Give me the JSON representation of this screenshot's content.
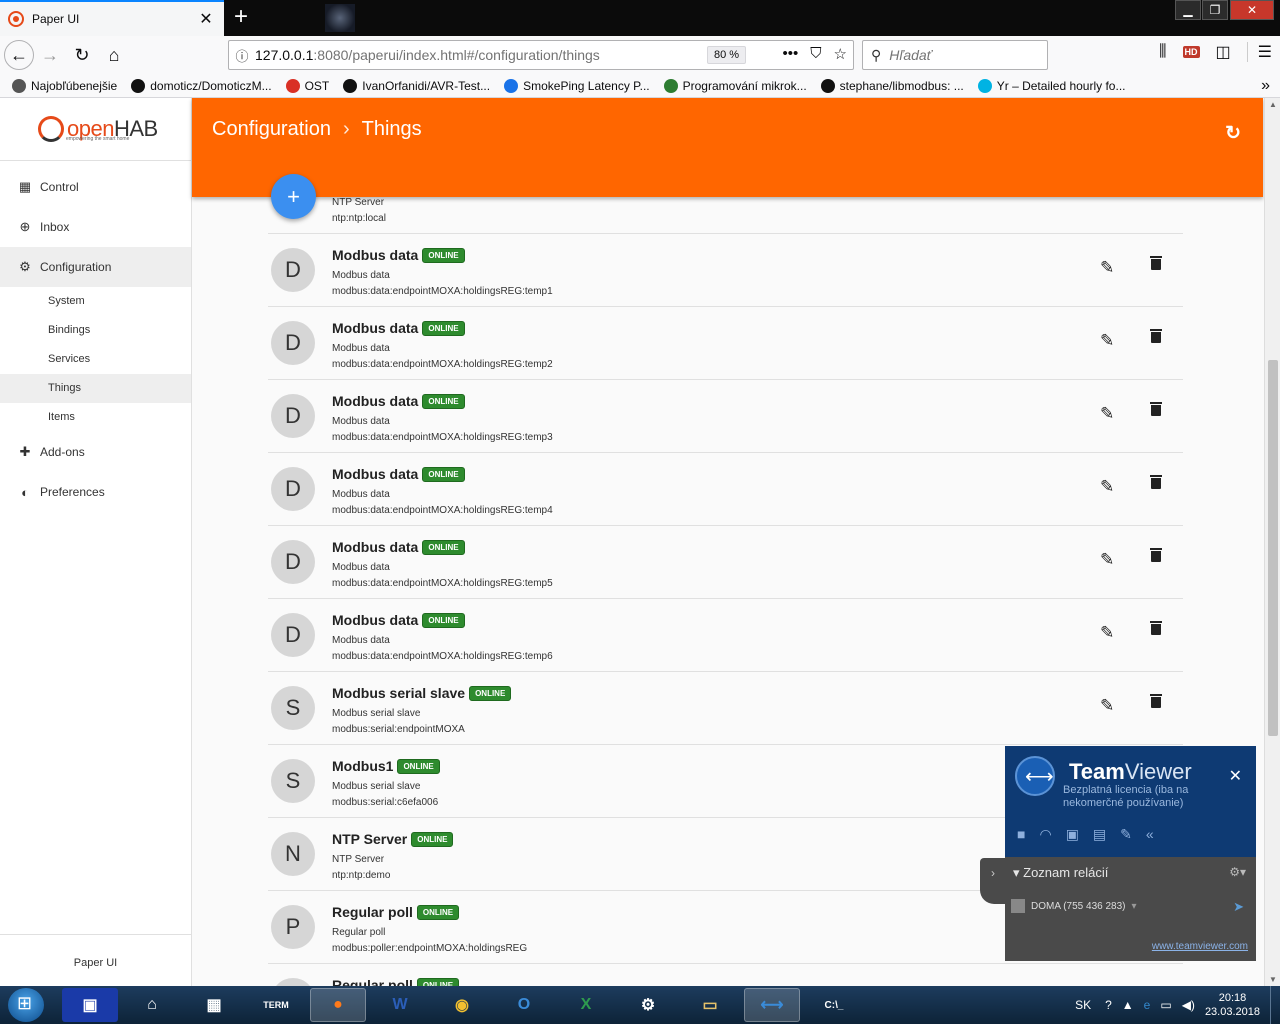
{
  "browser": {
    "tab_title": "Paper UI",
    "tab_close": "✕",
    "new_tab": "+",
    "url_host": "127.0.0.1",
    "url_rest": ":8080/paperui/index.html#/configuration/things",
    "zoom": "80 %",
    "search_placeholder": "Hľadať",
    "bookmarks": [
      {
        "label": "Najobľúbenejšie",
        "icon": "gear-icon",
        "color": "#555555"
      },
      {
        "label": "domoticz/DomoticzM...",
        "icon": "github-icon",
        "color": "#111111"
      },
      {
        "label": "OST",
        "icon": "map-pin-icon",
        "color": "#d93025"
      },
      {
        "label": "IvanOrfanidi/AVR-Test...",
        "icon": "github-icon",
        "color": "#111111"
      },
      {
        "label": "SmokePing Latency P...",
        "icon": "smokeping-icon",
        "color": "#1a73e8"
      },
      {
        "label": "Programování mikrok...",
        "icon": "hash-icon",
        "color": "#2e7d32"
      },
      {
        "label": "stephane/libmodbus: ...",
        "icon": "github-icon",
        "color": "#111111"
      },
      {
        "label": "Yr – Detailed hourly fo...",
        "icon": "yr-icon",
        "color": "#00b3e3"
      }
    ]
  },
  "sidebar": {
    "logo_text_a": "open",
    "logo_text_b": "HAB",
    "logo_sub": "empowering the smart home",
    "items": [
      {
        "label": "Control",
        "icon": "dashboard-icon"
      },
      {
        "label": "Inbox",
        "icon": "plus-circle-icon"
      },
      {
        "label": "Configuration",
        "icon": "gear-icon"
      }
    ],
    "sub_items": [
      "System",
      "Bindings",
      "Services",
      "Things",
      "Items"
    ],
    "items2": [
      {
        "label": "Add-ons",
        "icon": "puzzle-icon"
      },
      {
        "label": "Preferences",
        "icon": "preferences-icon"
      }
    ],
    "footer": "Paper UI"
  },
  "header": {
    "crumb1": "Configuration",
    "sep": "›",
    "crumb2": "Things",
    "refresh": "↻"
  },
  "fab": "+",
  "partial_top": {
    "type": "NTP Server",
    "uid": "ntp:ntp:local"
  },
  "things": [
    {
      "initial": "D",
      "name": "Modbus data",
      "status": "ONLINE",
      "type": "Modbus data",
      "uid": "modbus:data:endpointMOXA:holdingsREG:temp1",
      "actions": true
    },
    {
      "initial": "D",
      "name": "Modbus data",
      "status": "ONLINE",
      "type": "Modbus data",
      "uid": "modbus:data:endpointMOXA:holdingsREG:temp2",
      "actions": true
    },
    {
      "initial": "D",
      "name": "Modbus data",
      "status": "ONLINE",
      "type": "Modbus data",
      "uid": "modbus:data:endpointMOXA:holdingsREG:temp3",
      "actions": true
    },
    {
      "initial": "D",
      "name": "Modbus data",
      "status": "ONLINE",
      "type": "Modbus data",
      "uid": "modbus:data:endpointMOXA:holdingsREG:temp4",
      "actions": true
    },
    {
      "initial": "D",
      "name": "Modbus data",
      "status": "ONLINE",
      "type": "Modbus data",
      "uid": "modbus:data:endpointMOXA:holdingsREG:temp5",
      "actions": true
    },
    {
      "initial": "D",
      "name": "Modbus data",
      "status": "ONLINE",
      "type": "Modbus data",
      "uid": "modbus:data:endpointMOXA:holdingsREG:temp6",
      "actions": true
    },
    {
      "initial": "S",
      "name": "Modbus serial slave",
      "status": "ONLINE",
      "type": "Modbus serial slave",
      "uid": "modbus:serial:endpointMOXA",
      "actions": true
    },
    {
      "initial": "S",
      "name": "Modbus1",
      "status": "ONLINE",
      "type": "Modbus serial slave",
      "uid": "modbus:serial:c6efa006",
      "actions": false
    },
    {
      "initial": "N",
      "name": "NTP Server",
      "status": "ONLINE",
      "type": "NTP Server",
      "uid": "ntp:ntp:demo",
      "actions": false
    },
    {
      "initial": "P",
      "name": "Regular poll",
      "status": "ONLINE",
      "type": "Regular poll",
      "uid": "modbus:poller:endpointMOXA:holdingsREG",
      "actions": false
    },
    {
      "initial": "P",
      "name": "Regular poll",
      "status": "ONLINE",
      "type": "",
      "uid": "",
      "actions": false
    }
  ],
  "teamviewer": {
    "brand_a": "Team",
    "brand_b": "Viewer",
    "license": "Bezplatná licencia (iba na nekomerčné používanie)",
    "sessions_title": "Zoznam relácií",
    "session": "DOMA (755 436 283)",
    "link": "www.teamviewer.com",
    "close": "✕"
  },
  "taskbar": {
    "lang": "SK",
    "time": "20:18",
    "date": "23.03.2018"
  },
  "colors": {
    "accent": "#ff6600",
    "fab": "#3b8ff0",
    "online": "#2e8b2e"
  }
}
